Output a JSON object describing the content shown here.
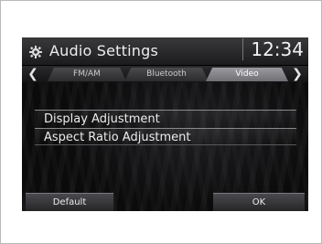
{
  "header": {
    "title": "Audio Settings",
    "time": "12:34",
    "icon": "gear-icon"
  },
  "tabs": [
    {
      "label": "FM/AM",
      "selected": false
    },
    {
      "label": "Bluetooth",
      "selected": false
    },
    {
      "label": "Video",
      "selected": true
    }
  ],
  "nav": {
    "left_icon": "chevron-left-icon",
    "right_icon": "chevron-right-icon"
  },
  "menu": {
    "items": [
      {
        "label": "Display Adjustment"
      },
      {
        "label": "Aspect Ratio Adjustment"
      }
    ]
  },
  "footer": {
    "default_label": "Default",
    "ok_label": "OK"
  }
}
